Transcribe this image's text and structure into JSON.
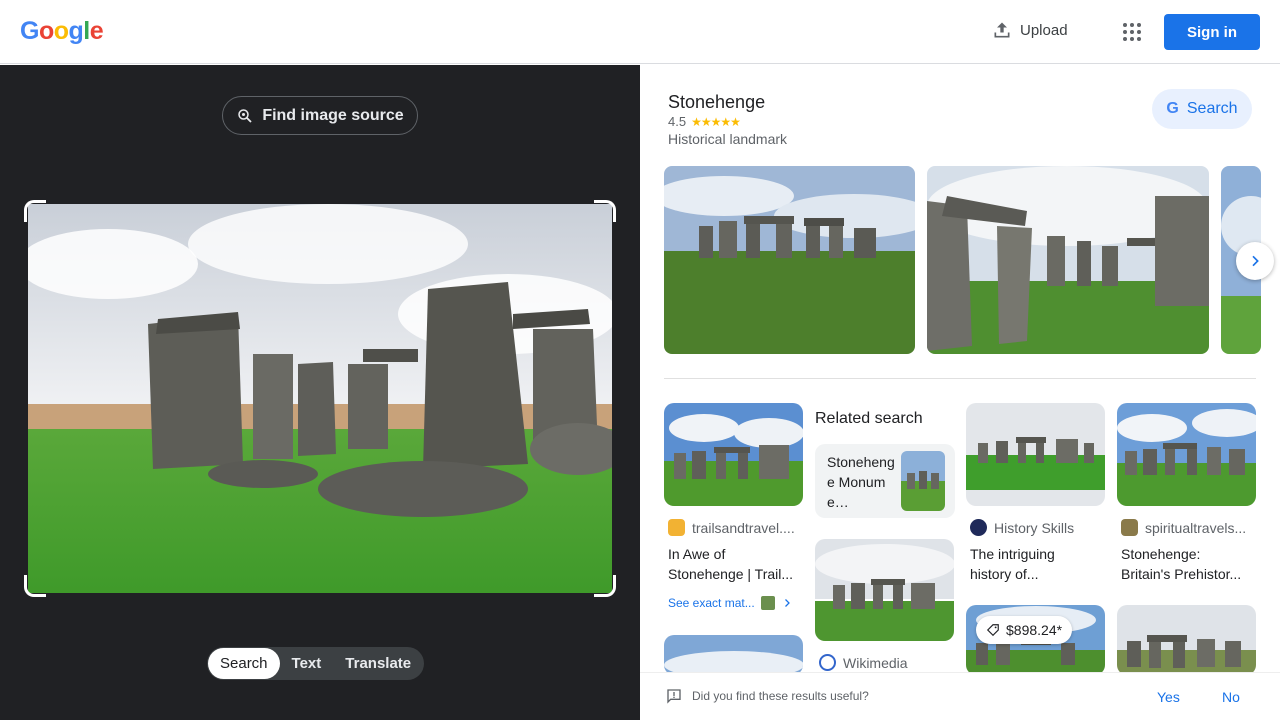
{
  "header": {
    "logo_letters": [
      {
        "ch": "G",
        "color": "#4285f4"
      },
      {
        "ch": "o",
        "color": "#ea4335"
      },
      {
        "ch": "o",
        "color": "#fbbc05"
      },
      {
        "ch": "g",
        "color": "#4285f4"
      },
      {
        "ch": "l",
        "color": "#34a853"
      },
      {
        "ch": "e",
        "color": "#ea4335"
      }
    ],
    "upload_label": "Upload",
    "upload_icon": "upload-icon",
    "apps_icon": "apps-grid-icon",
    "signin_label": "Sign in"
  },
  "left": {
    "find_source_label": "Find image source",
    "modes": [
      {
        "label": "Search",
        "active": true
      },
      {
        "label": "Text",
        "active": false
      },
      {
        "label": "Translate",
        "active": false
      }
    ]
  },
  "knowledge_panel": {
    "title": "Stonehenge",
    "rating": "4.5",
    "stars": "★★★★★",
    "type": "Historical landmark",
    "search_label": "Search"
  },
  "results": {
    "related_title": "Related search",
    "related_label": "Stonehenge Monume…",
    "cards": [
      {
        "source": "trailsandtravel....",
        "caption_1": "In Awe of",
        "caption_2": "Stonehenge | Trail..."
      },
      {
        "source": "History Skills",
        "caption_1": "The intriguing",
        "caption_2": "history of..."
      },
      {
        "source": "spiritualtravels...",
        "caption_1": "Stonehenge:",
        "caption_2": "Britain's Prehistor..."
      },
      {
        "source": "Wikimedia"
      }
    ],
    "exact_match": "See exact mat...",
    "price": "$898.24*"
  },
  "feedback": {
    "question": "Did you find these results useful?",
    "yes": "Yes",
    "no": "No"
  },
  "colors": {
    "accent": "#1a73e8",
    "dark_panel": "#202124",
    "grass": "#4caf3a",
    "stone": "#6d6d68"
  }
}
